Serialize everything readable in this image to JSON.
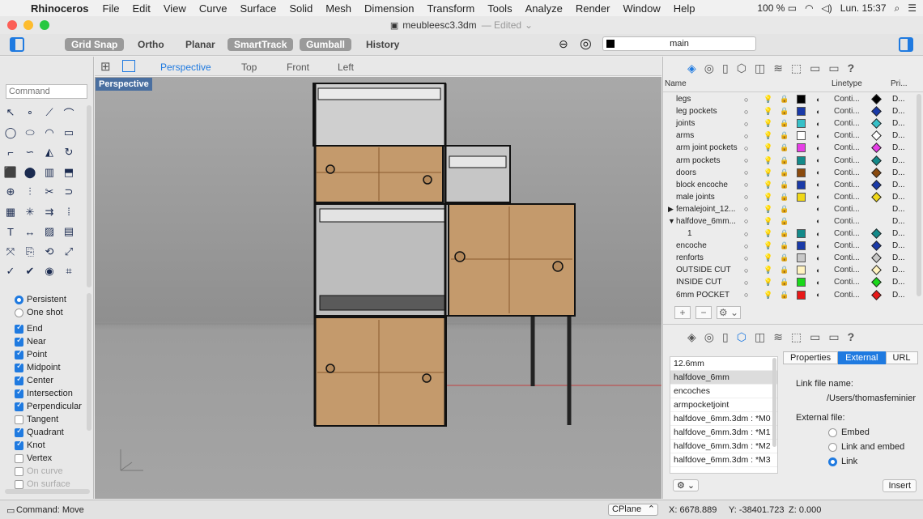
{
  "menubar": {
    "app_name": "Rhinoceros",
    "items": [
      "File",
      "Edit",
      "View",
      "Curve",
      "Surface",
      "Solid",
      "Mesh",
      "Dimension",
      "Transform",
      "Tools",
      "Analyze",
      "Render",
      "Window",
      "Help"
    ],
    "battery": "100 %",
    "clock": "Lun. 15:37"
  },
  "window": {
    "title": "meubleesc3.3dm",
    "status": "— Edited"
  },
  "toolbar": {
    "grid_snap": "Grid Snap",
    "ortho": "Ortho",
    "planar": "Planar",
    "smarttrack": "SmartTrack",
    "gumball": "Gumball",
    "history": "History",
    "current_layer": "main"
  },
  "command": {
    "placeholder": "Command"
  },
  "tools": [
    "arrow-icon",
    "point-icon",
    "polyline-icon",
    "curve-icon",
    "circle-icon",
    "ellipse-icon",
    "arc-icon",
    "rectangle-icon",
    "fillet-icon",
    "blend-icon",
    "surface-icon",
    "revolve-icon",
    "box-icon",
    "sphere-icon",
    "cylinder-icon",
    "extrude-icon",
    "boolean-icon",
    "split-icon",
    "trim-icon",
    "join-icon",
    "mesh-icon",
    "explode-icon",
    "offset-icon",
    "array-icon",
    "text-icon",
    "dim-icon",
    "hatch-icon",
    "layout-icon",
    "move-icon",
    "copy-icon",
    "rotate-icon",
    "scale-icon",
    "check-icon",
    "tick-icon",
    "render-icon",
    "camera-icon"
  ],
  "osnap": {
    "persistent": "Persistent",
    "one_shot": "One shot",
    "items": [
      {
        "label": "End",
        "checked": true
      },
      {
        "label": "Near",
        "checked": true
      },
      {
        "label": "Point",
        "checked": true
      },
      {
        "label": "Midpoint",
        "checked": true
      },
      {
        "label": "Center",
        "checked": true
      },
      {
        "label": "Intersection",
        "checked": true
      },
      {
        "label": "Perpendicular",
        "checked": true
      },
      {
        "label": "Tangent",
        "checked": false
      },
      {
        "label": "Quadrant",
        "checked": true
      },
      {
        "label": "Knot",
        "checked": true
      },
      {
        "label": "Vertex",
        "checked": false
      },
      {
        "label": "On curve",
        "checked": false,
        "disabled": true
      },
      {
        "label": "On surface",
        "checked": false,
        "disabled": true
      }
    ]
  },
  "viewport": {
    "tabs": [
      "Perspective",
      "Top",
      "Front",
      "Left"
    ],
    "active": "Perspective",
    "label": "Perspective"
  },
  "layers_panel": {
    "columns": {
      "name": "Name",
      "linetype": "Linetype",
      "print": "Pri..."
    },
    "rows": [
      {
        "name": "legs",
        "color": "#000000",
        "linetype": "Conti...",
        "print": "D...",
        "indent": 0
      },
      {
        "name": "leg pockets",
        "color": "#1a3aa8",
        "linetype": "Conti...",
        "print": "D...",
        "indent": 0
      },
      {
        "name": "joints",
        "color": "#36c0c8",
        "linetype": "Conti...",
        "print": "D...",
        "indent": 0
      },
      {
        "name": "arms",
        "color": "#ffffff",
        "linetype": "Conti...",
        "print": "D...",
        "indent": 0
      },
      {
        "name": "arm joint pockets",
        "color": "#e63ee6",
        "linetype": "Conti...",
        "print": "D...",
        "indent": 0
      },
      {
        "name": "arm pockets",
        "color": "#138a8a",
        "linetype": "Conti...",
        "print": "D...",
        "indent": 0
      },
      {
        "name": "doors",
        "color": "#8a4a0e",
        "linetype": "Conti...",
        "print": "D...",
        "indent": 0
      },
      {
        "name": "block encoche",
        "color": "#1a3aa8",
        "linetype": "Conti...",
        "print": "D...",
        "indent": 0
      },
      {
        "name": "male joints",
        "color": "#f0d818",
        "linetype": "Conti...",
        "print": "D...",
        "indent": 0
      },
      {
        "name": "femalejoint_12...",
        "color": "",
        "linetype": "Conti...",
        "print": "D...",
        "indent": 0,
        "expander": "▶"
      },
      {
        "name": "halfdove_6mm...",
        "color": "",
        "linetype": "Conti...",
        "print": "D...",
        "indent": 0,
        "expander": "▼"
      },
      {
        "name": "1",
        "color": "#138a8a",
        "linetype": "Conti...",
        "print": "D...",
        "indent": 1
      },
      {
        "name": "encoche",
        "color": "#1a3aa8",
        "linetype": "Conti...",
        "print": "D...",
        "indent": 0
      },
      {
        "name": "renforts",
        "color": "#c8c8c8",
        "linetype": "Conti...",
        "print": "D...",
        "indent": 0
      },
      {
        "name": "OUTSIDE CUT",
        "color": "#fff3c0",
        "linetype": "Conti...",
        "print": "D...",
        "indent": 0
      },
      {
        "name": "INSIDE CUT",
        "color": "#1ad81a",
        "linetype": "Conti...",
        "print": "D...",
        "indent": 0
      },
      {
        "name": "6mm POCKET",
        "color": "#e81818",
        "linetype": "Conti...",
        "print": "D...",
        "indent": 0
      }
    ]
  },
  "linked_blocks": {
    "items": [
      "12.6mm",
      "halfdove_6mm",
      "encoches",
      "armpocketjoint",
      "halfdove_6mm.3dm : *M0",
      "halfdove_6mm.3dm : *M1",
      "halfdove_6mm.3dm : *M2",
      "halfdove_6mm.3dm : *M3"
    ],
    "selected": "halfdove_6mm",
    "tabs": [
      "Properties",
      "External",
      "URL"
    ],
    "active_tab": "External",
    "link_file_label": "Link file name:",
    "link_file_value": "/Users/thomasfeminier",
    "external_label": "External file:",
    "options": [
      "Embed",
      "Link and embed",
      "Link"
    ],
    "selected_option": "Link",
    "insert_label": "Insert"
  },
  "status": {
    "command": "Command: Move",
    "cplane": "CPlane",
    "x": "X: 6678.889",
    "y": "Y: -38401.723",
    "z": "Z: 0.000"
  },
  "colors": {
    "accent": "#1f7ae0",
    "wood": "#c49a6c",
    "viewport_bg": "#9e9e9e"
  }
}
